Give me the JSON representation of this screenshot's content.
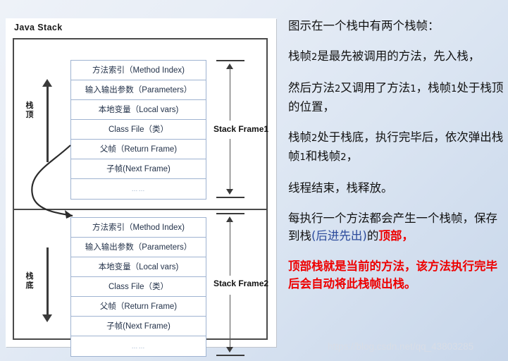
{
  "diagram": {
    "title": "Java Stack",
    "top_label": "栈顶",
    "bottom_label": "栈底",
    "frame1_label": "Stack Frame1",
    "frame2_label": "Stack Frame2",
    "rows": [
      "方法索引（Method Index)",
      "输入输出参数（Parameters）",
      "本地变量（Local vars)",
      "Class File（类）",
      "父帧（Return Frame)",
      "子帧(Next Frame)",
      "……"
    ]
  },
  "text": {
    "p1": "图示在一个栈中有两个栈帧：",
    "p2_a": "栈帧",
    "p2_n": "2",
    "p2_b": "是最先被调用的方法，先入栈，",
    "p3_a": "然后方法",
    "p3_n1": "2",
    "p3_b": "又调用了方法",
    "p3_n2": "1",
    "p3_c": "，栈帧",
    "p3_n3": "1",
    "p3_d": "处于栈顶的位置，",
    "p4_a": "栈帧",
    "p4_n1": "2",
    "p4_b": "处于栈底，执行完毕后，依次弹出栈帧",
    "p4_n2": "1",
    "p4_c": "和栈帧",
    "p4_n3": "2",
    "p4_d": "，",
    "p5": "线程结束，栈释放。",
    "p6_a": "每执行一个方法都会产生一个栈帧，保存到栈",
    "p6_paren": "(后进先出)",
    "p6_b": "的",
    "p6_red": "顶部，",
    "p7": "顶部栈就是当前的方法，该方法执行完毕 后会自动将此栈帧出栈。"
  },
  "watermark": "https://blog.csdn.net/qq_43803285"
}
